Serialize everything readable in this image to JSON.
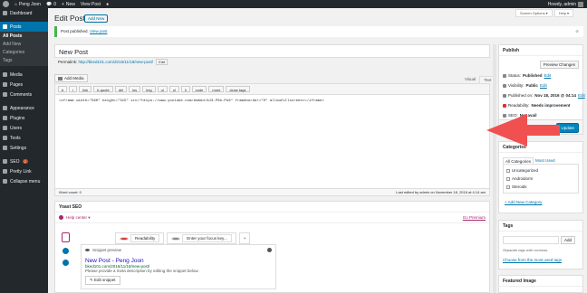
{
  "admin_bar": {
    "site_name": "Peng Joon",
    "comments_count": "0",
    "new_label": "New",
    "view_post": "View Post",
    "howdy": "Howdy, admin"
  },
  "menu": {
    "dashboard": "Dashboard",
    "posts": "Posts",
    "posts_sub": [
      "All Posts",
      "Add New",
      "Categories",
      "Tags"
    ],
    "media": "Media",
    "pages": "Pages",
    "comments": "Comments",
    "appearance": "Appearance",
    "plugins": "Plugins",
    "users": "Users",
    "tools": "Tools",
    "settings": "Settings",
    "seo": "SEO",
    "seo_badge": "2",
    "pretty_link": "Pretty Link",
    "collapse": "Collapse menu"
  },
  "screen_options": {
    "screen": "Screen Options ▾",
    "help": "Help ▾"
  },
  "page": {
    "title": "Edit Post",
    "add_new": "Add New"
  },
  "notice": {
    "text": "Post published.",
    "link": "View post"
  },
  "post": {
    "title": "New Post",
    "permalink_label": "Permalink:",
    "permalink_url": "http://bked101.com/2016/11/18/new-post/",
    "permalink_edit": "Edit",
    "add_media": "Add Media",
    "tab_visual": "Visual",
    "tab_text": "Text",
    "quicktags": [
      "b",
      "i",
      "link",
      "b-quote",
      "del",
      "ins",
      "img",
      "ul",
      "ol",
      "li",
      "code",
      "more",
      "close tags"
    ],
    "content": "<iframe width=\"560\" height=\"315\" src=\"https://www.youtube.com/embed/AJ3-P6h-Pk8\" frameborder=\"0\" allowfullscreen></iframe>",
    "word_count": "Word count: 0",
    "last_edited": "Last edited by admin on November 18, 2016 at 4:14 am"
  },
  "yoast": {
    "title": "Yoast SEO",
    "help_center": "Help center ▾",
    "go_premium": "Go Premium",
    "tab_readability": "Readability",
    "tab_keyword": "Enter your focus key...",
    "tab_add": "+",
    "snippet_heading": "Snippet preview",
    "snippet_title": "New Post - Peng Joon",
    "snippet_url": "bked101.com/2016/11/18/new-post/",
    "snippet_desc": "Please provide a meta description by editing the snippet below.",
    "edit_snippet": "Edit snippet"
  },
  "publish": {
    "title": "Publish",
    "preview": "Preview Changes",
    "status_label": "Status:",
    "status_value": "Published",
    "status_edit": "Edit",
    "visibility_label": "Visibility:",
    "visibility_value": "Public",
    "visibility_edit": "Edit",
    "published_label": "Published on:",
    "published_value": "Nov 18, 2016 @ 04:14",
    "published_edit": "Edit",
    "readability_label": "Readability:",
    "readability_value": "Needs improvement",
    "seo_label": "SEO:",
    "seo_value": "Not avail",
    "update": "Update"
  },
  "categories": {
    "title": "Categories",
    "tab_all": "All Categories",
    "tab_used": "Most Used",
    "items": [
      "Uncategorized",
      "Androidorm",
      "Steroids"
    ],
    "add_new": "+ Add New Category"
  },
  "tags": {
    "title": "Tags",
    "add": "Add",
    "separate": "Separate tags with commas",
    "choose": "Choose from the most used tags"
  },
  "featured": {
    "title": "Featured Image"
  },
  "colors": {
    "accent": "#0073aa",
    "arrow": "#f05050",
    "notice": "#46b450",
    "yoast": "#a4286a"
  }
}
